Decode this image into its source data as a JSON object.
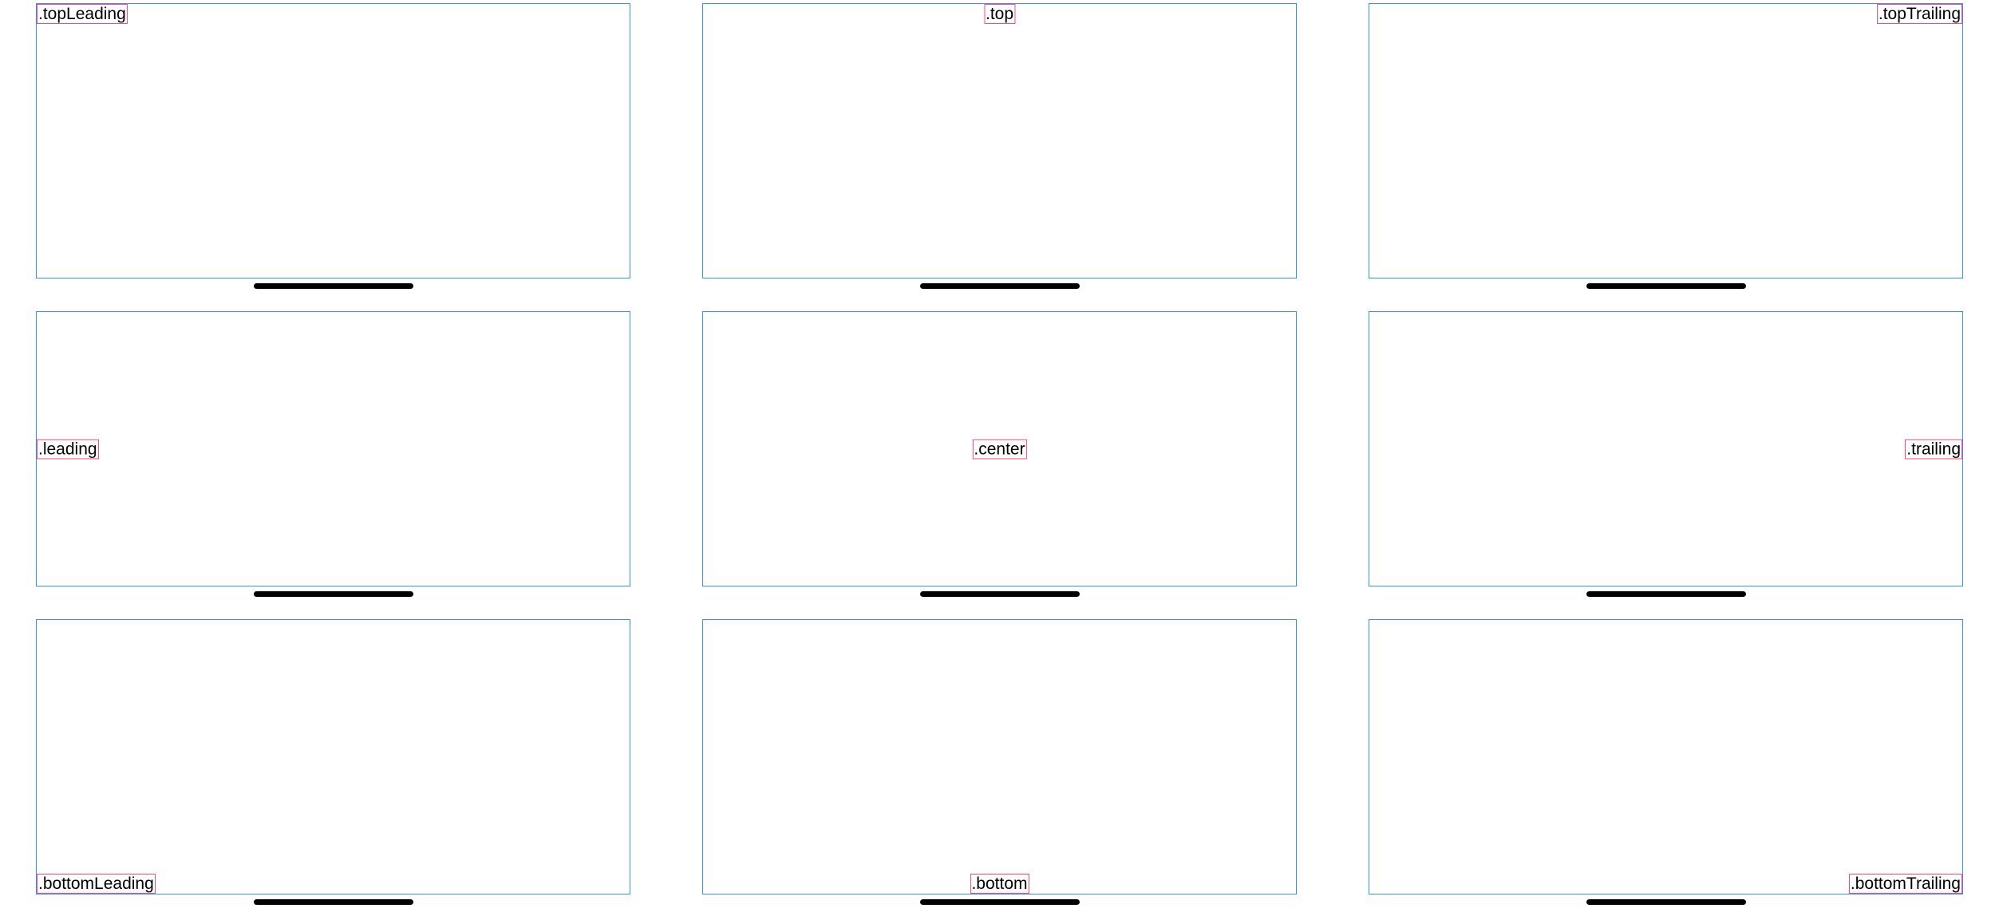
{
  "cells": [
    {
      "name": ".topLeading",
      "pos": "pos-topLeading"
    },
    {
      "name": ".top",
      "pos": "pos-top"
    },
    {
      "name": ".topTrailing",
      "pos": "pos-topTrailing"
    },
    {
      "name": ".leading",
      "pos": "pos-leading"
    },
    {
      "name": ".center",
      "pos": "pos-center"
    },
    {
      "name": ".trailing",
      "pos": "pos-trailing"
    },
    {
      "name": ".bottomLeading",
      "pos": "pos-bottomLeading"
    },
    {
      "name": ".bottom",
      "pos": "pos-bottom"
    },
    {
      "name": ".bottomTrailing",
      "pos": "pos-bottomTrailing"
    }
  ]
}
